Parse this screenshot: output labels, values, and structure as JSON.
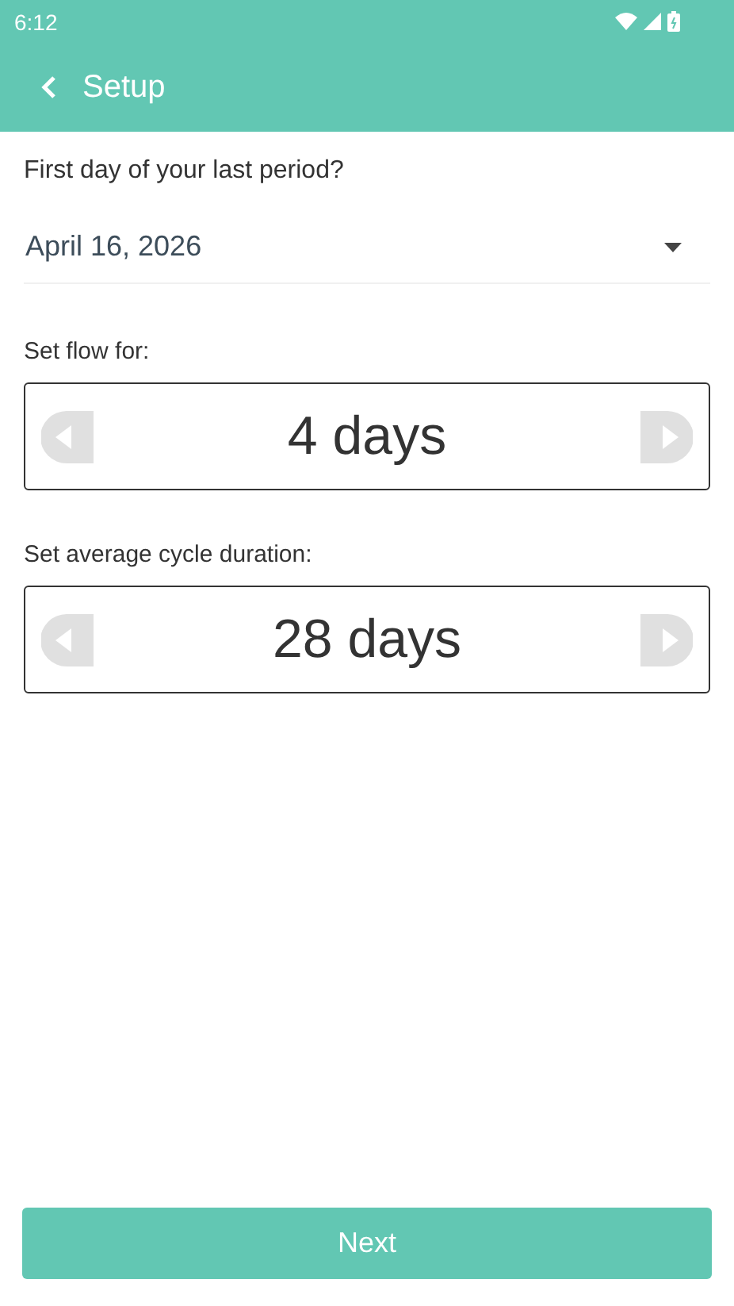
{
  "status_bar": {
    "time": "6:12"
  },
  "app_bar": {
    "title": "Setup"
  },
  "date_question": {
    "label": "First day of your last period?",
    "value": "April 16, 2026"
  },
  "steppers": [
    {
      "label": "Set flow for:",
      "value": "4 days"
    },
    {
      "label": "Set average cycle duration:",
      "value": "28 days"
    }
  ],
  "next_button": {
    "label": "Next"
  }
}
